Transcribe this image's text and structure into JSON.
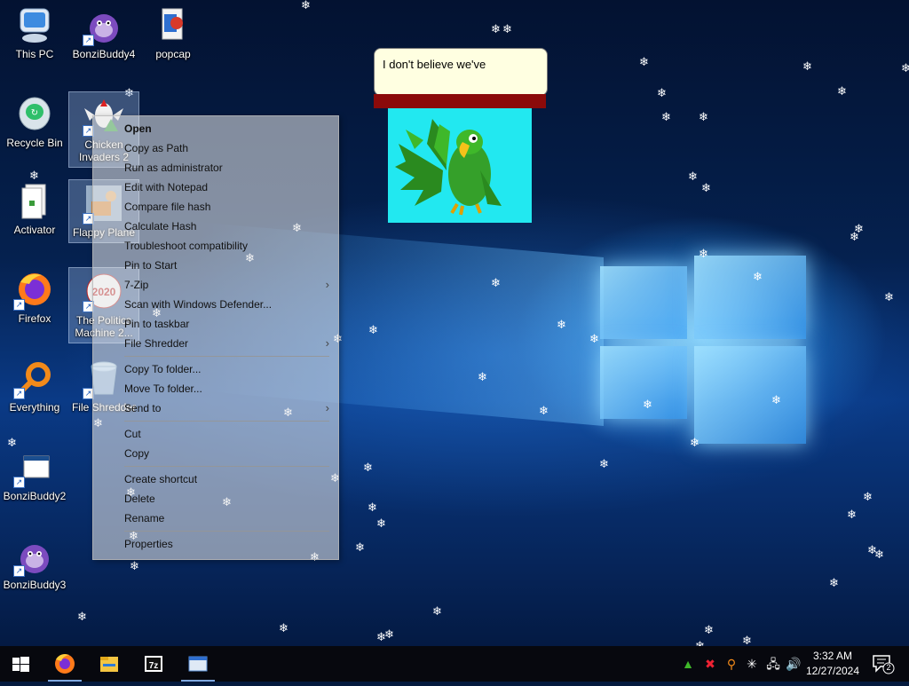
{
  "desktop_icons": {
    "this_pc": "This PC",
    "bonzibuddy4": "BonziBuddy4",
    "popcap": "popcap",
    "recycle_bin": "Recycle Bin",
    "chicken_invaders": "Chicken Invaders 2",
    "activator": "Activator",
    "flappy_plane": "Flappy Plane",
    "firefox": "Firefox",
    "politics_machine": "The Politics Machine 2...",
    "everything": "Everything",
    "file_shredder": "File Shredder",
    "bonzibuddy2": "BonziBuddy2",
    "bonzibuddy3": "BonziBuddy3"
  },
  "politics_badge": "2020",
  "context_menu": {
    "items": [
      {
        "label": "Open"
      },
      {
        "label": "Copy as Path"
      },
      {
        "label": "Run as administrator"
      },
      {
        "label": "Edit with Notepad"
      },
      {
        "label": "Compare file hash"
      },
      {
        "label": "Calculate Hash"
      },
      {
        "label": "Troubleshoot compatibility"
      },
      {
        "label": "Pin to Start"
      },
      {
        "label": "7-Zip"
      },
      {
        "label": "Scan with Windows Defender..."
      },
      {
        "label": "Pin to taskbar"
      },
      {
        "label": "File Shredder"
      },
      {
        "label": "Copy To folder..."
      },
      {
        "label": "Move To folder..."
      },
      {
        "label": "Send to"
      },
      {
        "label": "Cut"
      },
      {
        "label": "Copy"
      },
      {
        "label": "Create shortcut"
      },
      {
        "label": "Delete"
      },
      {
        "label": "Rename"
      },
      {
        "label": "Properties"
      }
    ],
    "submenu_glyph": "›"
  },
  "speech_bubble": {
    "text": "I don't believe we've"
  },
  "taskbar": {
    "icons": [
      "windows-start-icon",
      "firefox-icon",
      "file-explorer-icon",
      "7zip-icon",
      "window-app-icon"
    ],
    "zip_label": "7z",
    "clock": {
      "time": "3:32 AM",
      "date": "12/27/2024"
    },
    "notification_count": "2"
  },
  "colors": {
    "bubble_bg": "#ffffe1",
    "bubble_bar": "#8b0a0a",
    "parrot_bg": "#22e8f0",
    "taskbar": "#07080e",
    "taskbar_accent": "#7fa8e0"
  }
}
